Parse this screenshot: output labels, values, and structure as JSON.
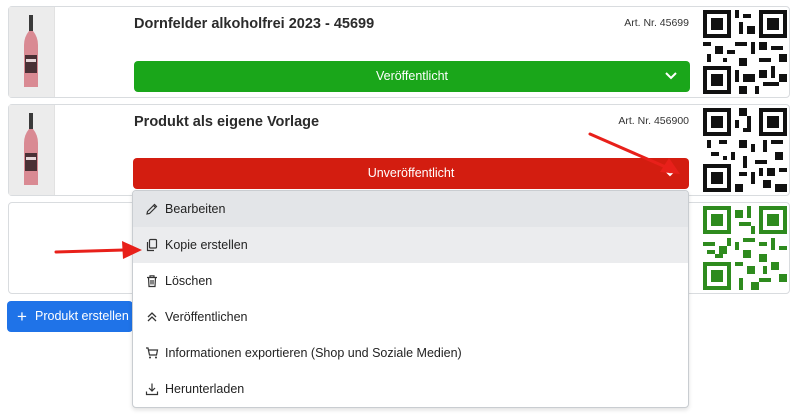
{
  "products": [
    {
      "title": "Dornfelder alkoholfrei 2023 - 45699",
      "art_nr": "Art. Nr. 45699",
      "status": "Veröffentlicht",
      "status_color": "#1aa61a"
    },
    {
      "title": "Produkt als eigene Vorlage",
      "art_nr": "Art. Nr. 456900",
      "status": "Unveröffentlicht",
      "status_color": "#d31d10"
    }
  ],
  "dropdown": {
    "items": [
      {
        "label": "Bearbeiten",
        "icon": "pencil-icon"
      },
      {
        "label": "Kopie erstellen",
        "icon": "copy-icon"
      },
      {
        "label": "Löschen",
        "icon": "trash-icon"
      },
      {
        "label": "Veröffentlichen",
        "icon": "double-chevron-up-icon"
      },
      {
        "label": "Informationen exportieren (Shop und Soziale Medien)",
        "icon": "cart-icon"
      },
      {
        "label": "Herunterladen",
        "icon": "download-icon"
      }
    ]
  },
  "create_button": {
    "label": "Produkt erstellen",
    "icon": "plus-icon"
  },
  "colors": {
    "primary": "#1f73e8",
    "green": "#1aa61a",
    "red": "#d31d10",
    "qr_green": "#2e8b1e",
    "annotation_arrow": "#e8201a"
  }
}
